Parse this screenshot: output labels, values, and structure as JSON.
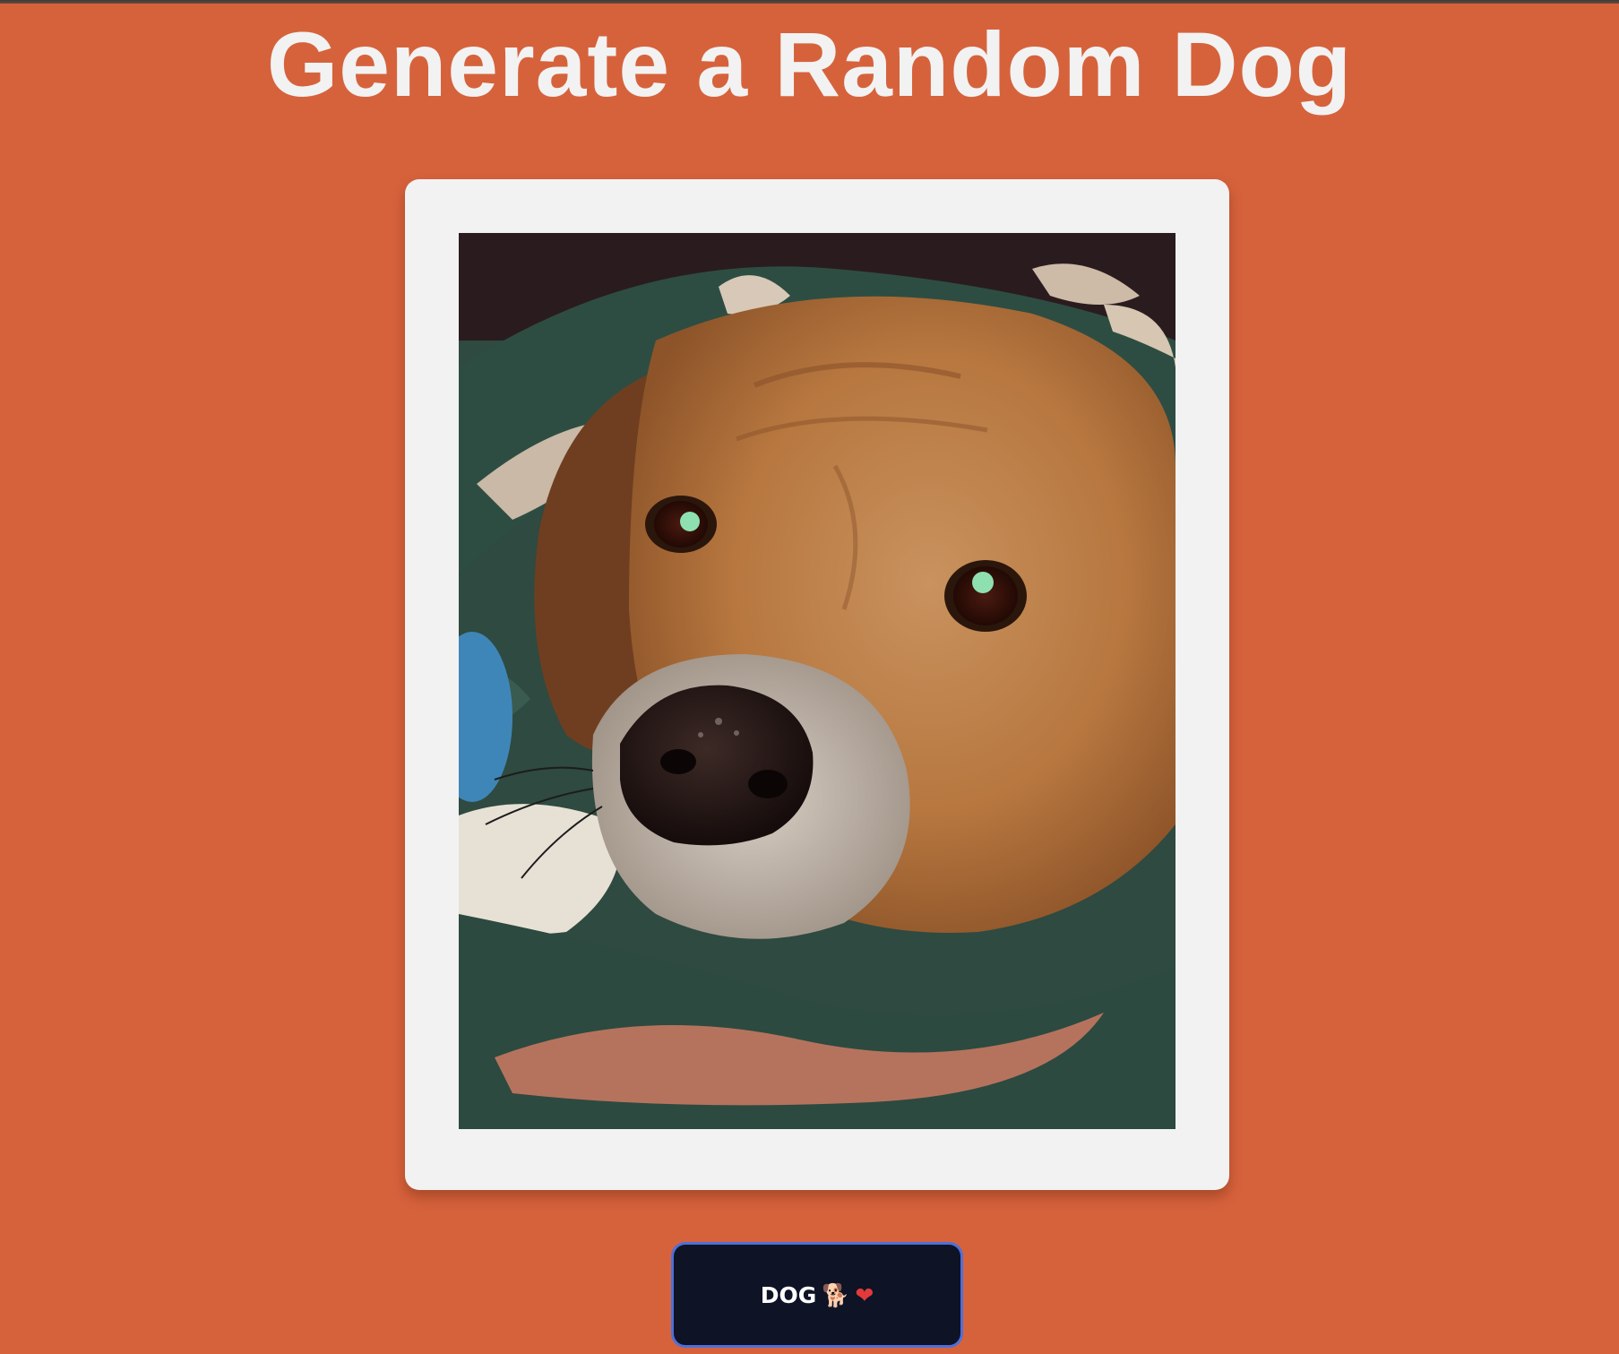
{
  "page": {
    "title": "Generate a Random Dog",
    "background_color": "#d6623c"
  },
  "photo": {
    "subject": "dog",
    "frame_color": "#f2f2f2"
  },
  "button": {
    "label": "DOG",
    "emoji_dog": "🐕",
    "emoji_heart": "❤",
    "background_color": "#0e1326",
    "border_color": "#4f6fd8"
  }
}
